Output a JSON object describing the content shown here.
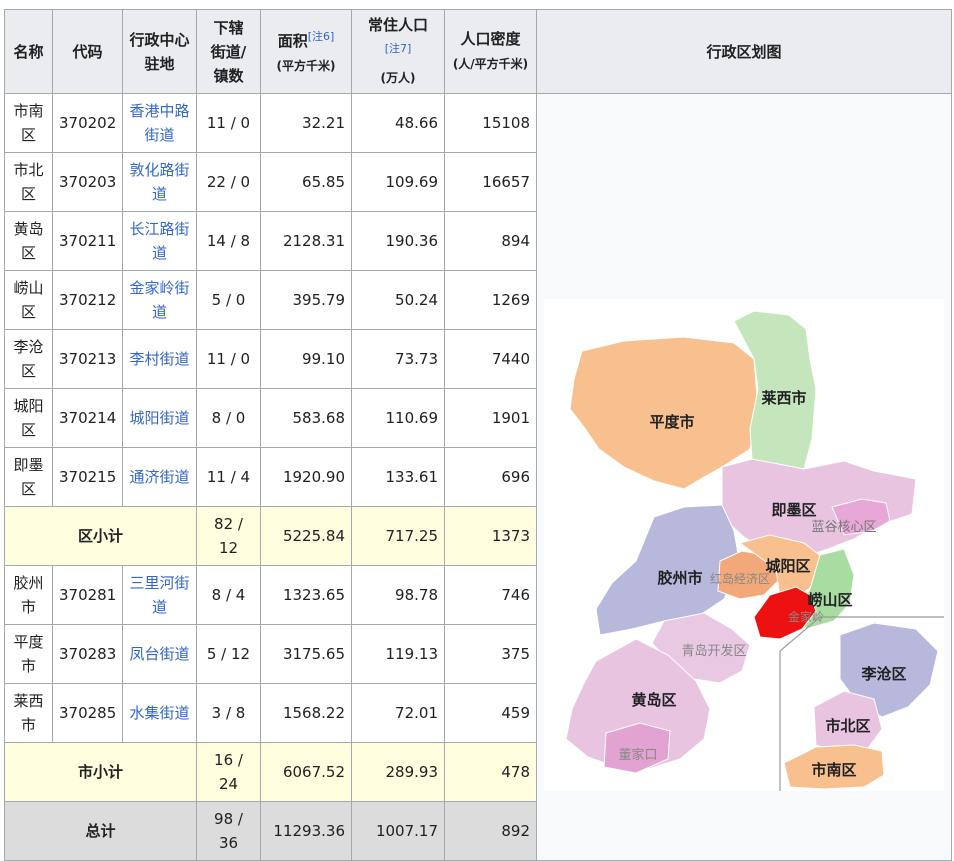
{
  "headers": {
    "name": "名称",
    "code": "代码",
    "seat_a": "行政中心",
    "seat_b": "驻地",
    "sub_a": "下辖",
    "sub_b": "街道/",
    "sub_c": "镇数",
    "area": "面积",
    "area_note": "[注6]",
    "area_unit": "(平方千米)",
    "pop": "常住人口",
    "pop_note": "[注7]",
    "pop_unit": "(万人)",
    "density": "人口密度",
    "density_unit": "(人/平方千米)",
    "map": "行政区划图"
  },
  "rows": [
    {
      "name": "市南区",
      "code": "370202",
      "seat": "香港中路街道",
      "sub": "11 / 0",
      "area": "32.21",
      "pop": "48.66",
      "density": "15108"
    },
    {
      "name": "市北区",
      "code": "370203",
      "seat": "敦化路街道",
      "sub": "22 / 0",
      "area": "65.85",
      "pop": "109.69",
      "density": "16657"
    },
    {
      "name": "黄岛区",
      "code": "370211",
      "seat": "长江路街道",
      "sub": "14 / 8",
      "area": "2128.31",
      "pop": "190.36",
      "density": "894"
    },
    {
      "name": "崂山区",
      "code": "370212",
      "seat": "金家岭街道",
      "sub": "5 / 0",
      "area": "395.79",
      "pop": "50.24",
      "density": "1269"
    },
    {
      "name": "李沧区",
      "code": "370213",
      "seat": "李村街道",
      "sub": "11 / 0",
      "area": "99.10",
      "pop": "73.73",
      "density": "7440"
    },
    {
      "name": "城阳区",
      "code": "370214",
      "seat": "城阳街道",
      "sub": "8 / 0",
      "area": "583.68",
      "pop": "110.69",
      "density": "1901"
    },
    {
      "name": "即墨区",
      "code": "370215",
      "seat": "通济街道",
      "sub": "11 / 4",
      "area": "1920.90",
      "pop": "133.61",
      "density": "696"
    }
  ],
  "district_subtotal": {
    "label": "区小计",
    "sub": "82 / 12",
    "area": "5225.84",
    "pop": "717.25",
    "density": "1373"
  },
  "cities": [
    {
      "name": "胶州市",
      "code": "370281",
      "seat": "三里河街道",
      "sub": "8 / 4",
      "area": "1323.65",
      "pop": "98.78",
      "density": "746"
    },
    {
      "name": "平度市",
      "code": "370283",
      "seat": "凤台街道",
      "sub": "5 / 12",
      "area": "3175.65",
      "pop": "119.13",
      "density": "375"
    },
    {
      "name": "莱西市",
      "code": "370285",
      "seat": "水集街道",
      "sub": "3 / 8",
      "area": "1568.22",
      "pop": "72.01",
      "density": "459"
    }
  ],
  "city_subtotal": {
    "label": "市小计",
    "sub": "16 / 24",
    "area": "6067.52",
    "pop": "289.93",
    "density": "478"
  },
  "total": {
    "label": "总计",
    "sub": "98 / 36",
    "area": "11293.36",
    "pop": "1007.17",
    "density": "892"
  },
  "map_labels": {
    "pingdu": "平度市",
    "laixi": "莱西市",
    "jimo": "即墨区",
    "langu": "蓝谷核心区",
    "jiaozhou": "胶州市",
    "hongdao": "红岛经济区",
    "chengyang": "城阳区",
    "laoshan": "崂山区",
    "jinjialing": "金家岭",
    "kaifaqu": "青岛开发区",
    "huangdao": "黄岛区",
    "dongjiakou": "董家口",
    "licang": "李沧区",
    "shibei": "市北区",
    "shinan": "市南区"
  },
  "colors": {
    "pingdu": "#f9c08f",
    "laixi": "#c5e6bd",
    "jimo": "#e8c4e1",
    "langu": "#e7a8d8",
    "jiaozhou": "#b8b8dc",
    "hongdao": "#f2a878",
    "chengyang": "#f9c08f",
    "laoshan_active": "#ee1111",
    "laoshan_rest": "#a8dca0",
    "kaifaqu": "#e8c8e2",
    "huangdao": "#e8c4e1",
    "dongjiakou": "#e2a2d2",
    "licang": "#b8b8dc",
    "shibei": "#e8c4e1",
    "shinan": "#f9c08f"
  }
}
